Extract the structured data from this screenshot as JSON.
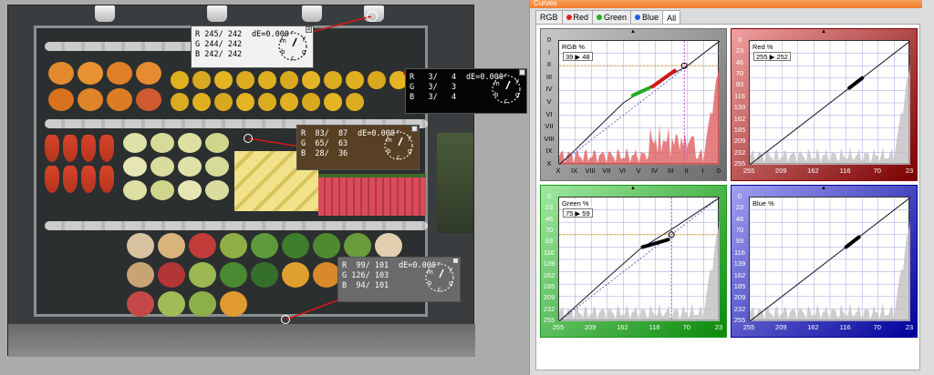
{
  "readouts": [
    {
      "r": "R 245/ 242",
      "g": "G 244/ 242",
      "b": "B 242/ 242",
      "de": "dE=0.000",
      "bg": "#f0f0f0",
      "fg": "#000000"
    },
    {
      "r": "R   3/   4",
      "g": "G   3/   3",
      "b": "B   3/   4",
      "de": "dE=0.000",
      "bg": "#050505",
      "fg": "#ffffff"
    },
    {
      "r": "R  83/  87",
      "g": "G  65/  63",
      "b": "B  28/  36",
      "de": "dE=0.000",
      "bg": "#574024",
      "fg": "#ffffff"
    },
    {
      "r": "R  99/ 101",
      "g": "G 126/ 103",
      "b": "B  94/ 101",
      "de": "dE=0.000",
      "bg": "#6a6a6a",
      "fg": "#ffffff"
    }
  ],
  "dial_letters": [
    "m",
    "r",
    "y",
    "g",
    "c",
    "b"
  ],
  "curves": {
    "title": "Curves",
    "tabs": [
      {
        "label": "RGB",
        "dot": ""
      },
      {
        "label": "Red",
        "dot": "#e02020"
      },
      {
        "label": "Green",
        "dot": "#20b020"
      },
      {
        "label": "Blue",
        "dot": "#2060e0"
      },
      {
        "label": "All",
        "dot": ""
      }
    ],
    "active_tab": "All",
    "panels": {
      "rgb": {
        "label": "RGB %",
        "input": "39",
        "output": "48",
        "arrow": "▶",
        "y_ticks": [
          "0",
          "I",
          "II",
          "III",
          "IV",
          "V",
          "VI",
          "VII",
          "VIII",
          "IX",
          "X"
        ],
        "x_ticks": [
          "X",
          "IX",
          "VIII",
          "VII",
          "VI",
          "V",
          "IV",
          "III",
          "II",
          "I",
          "0"
        ],
        "frame_color": "#6e6e6e"
      },
      "red": {
        "label": "Red %",
        "input": "255",
        "output": "252",
        "arrow": "▶",
        "y_ticks": [
          "0",
          "23",
          "46",
          "70",
          "93",
          "116",
          "139",
          "162",
          "185",
          "209",
          "232",
          "255"
        ],
        "x_ticks": [
          "255",
          "209",
          "162",
          "116",
          "70",
          "23"
        ],
        "frame_color": "#8a0000"
      },
      "green": {
        "label": "Green %",
        "input": "75",
        "output": "59",
        "arrow": "▶",
        "y_ticks": [
          "0",
          "23",
          "46",
          "70",
          "93",
          "116",
          "139",
          "162",
          "185",
          "209",
          "232",
          "255"
        ],
        "x_ticks": [
          "255",
          "209",
          "162",
          "116",
          "70",
          "23"
        ],
        "frame_color": "#1a9a1a"
      },
      "blue": {
        "label": "Blue %",
        "input": "",
        "output": "",
        "arrow": "",
        "y_ticks": [
          "0",
          "23",
          "46",
          "70",
          "93",
          "116",
          "139",
          "162",
          "185",
          "209",
          "232",
          "255"
        ],
        "x_ticks": [
          "255",
          "209",
          "162",
          "116",
          "70",
          "23"
        ],
        "frame_color": "#0000a0"
      }
    }
  }
}
